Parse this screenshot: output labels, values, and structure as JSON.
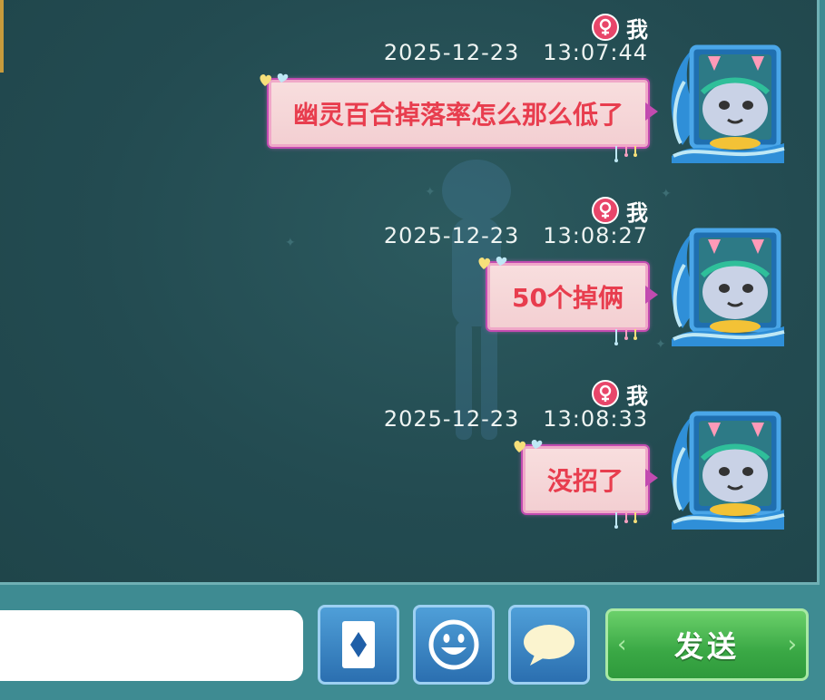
{
  "messages": [
    {
      "sender": "我",
      "timestamp": "2025-12-23   13:07:44",
      "text": "幽灵百合掉落率怎么那么低了"
    },
    {
      "sender": "我",
      "timestamp": "2025-12-23   13:08:27",
      "text": "50个掉俩"
    },
    {
      "sender": "我",
      "timestamp": "2025-12-23   13:08:33",
      "text": "没招了"
    }
  ],
  "input": {
    "value": "",
    "placeholder": ""
  },
  "toolbar": {
    "card_icon": "card-diamond-icon",
    "emoji_icon": "smiley-icon",
    "chat_icon": "speech-bubble-icon",
    "send_label": "发送"
  },
  "colors": {
    "panel_bg": "#234b51",
    "bubble_bg": "#f6d6d8",
    "bubble_text": "#e83d4e",
    "bubble_border": "#c24bb0",
    "gender_badge": "#e8466a",
    "tool_button": "#3a85c4",
    "send_button": "#3aa845",
    "footer_bg": "#3e8b92"
  }
}
